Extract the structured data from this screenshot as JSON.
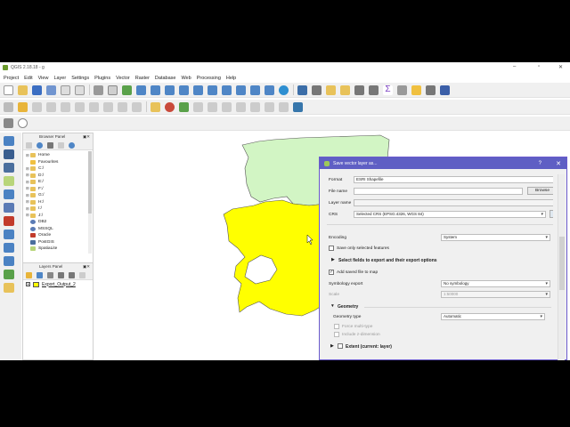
{
  "window": {
    "title": "QGIS 2.18.18 - g"
  },
  "menu": [
    "Project",
    "Edit",
    "View",
    "Layer",
    "Settings",
    "Plugins",
    "Vector",
    "Raster",
    "Database",
    "Web",
    "Processing",
    "Help"
  ],
  "browser_panel": {
    "title": "Browser Panel",
    "items": [
      {
        "label": "Home",
        "icon": "folder"
      },
      {
        "label": "Favourites",
        "icon": "star"
      },
      {
        "label": "C:/",
        "icon": "folder"
      },
      {
        "label": "D:/",
        "icon": "folder"
      },
      {
        "label": "E:/",
        "icon": "folder"
      },
      {
        "label": "F:/",
        "icon": "folder"
      },
      {
        "label": "G:/",
        "icon": "folder"
      },
      {
        "label": "H:/",
        "icon": "folder"
      },
      {
        "label": "I:/",
        "icon": "folder"
      },
      {
        "label": "J:/",
        "icon": "folder"
      },
      {
        "label": "DB2",
        "icon": "db"
      },
      {
        "label": "MSSQL",
        "icon": "db"
      },
      {
        "label": "Oracle",
        "icon": "oracle"
      },
      {
        "label": "PostGIS",
        "icon": "pg"
      },
      {
        "label": "SpatiaLite",
        "icon": "spatialite"
      }
    ]
  },
  "layers_panel": {
    "title": "Layers Panel",
    "layers": [
      {
        "name": "Export_Output_2",
        "visible": true
      }
    ]
  },
  "map": {
    "colors": {
      "yellow_polygon": "#ffff00",
      "green_polygon": "#d2f5c4",
      "outline": "#555555"
    }
  },
  "dialog": {
    "title": "Save vector layer as...",
    "help": "?",
    "close": "✕",
    "format_label": "Format",
    "format_value": "ESRI Shapefile",
    "filename_label": "File name",
    "filename_value": "",
    "browse_label": "Browse",
    "layername_label": "Layer name",
    "layername_value": "",
    "crs_label": "CRS",
    "crs_value": "Selected CRS (EPSG:4326, WGS 84)",
    "encoding_label": "Encoding",
    "encoding_value": "System",
    "save_selected_label": "Save only selected features",
    "select_fields_label": "Select fields to export and their export options",
    "add_to_map_label": "Add saved file to map",
    "add_to_map_checked": true,
    "symbology_label": "Symbology export",
    "symbology_value": "No symbology",
    "scale_label": "Scale",
    "scale_value": "1:50000",
    "geometry_section": "Geometry",
    "geometry_type_label": "Geometry type",
    "geometry_type_value": "Automatic",
    "force_multi_label": "Force multi-type",
    "include_z_label": "Include z-dimension",
    "extent_label": "Extent (current: layer)"
  },
  "accent": "#5f5fc4"
}
